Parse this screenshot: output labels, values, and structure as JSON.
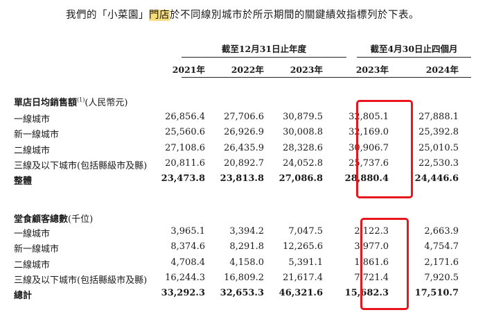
{
  "intro": {
    "before": "我們的「小菜園」",
    "highlight": "門店",
    "after": "於不同線別城市於所示期間的關鍵績效指標列於下表。"
  },
  "header": {
    "group1": "截至12月31日止年度",
    "group2": "截至4月30日止四個月",
    "years": [
      "2021年",
      "2022年",
      "2023年",
      "2023年",
      "2024年"
    ]
  },
  "section1": {
    "title": "單店日均銷售額",
    "note": "(1)",
    "unit": "(人民幣元)",
    "rows": [
      {
        "label": "一線城市",
        "values": [
          "26,856.4",
          "27,706.6",
          "30,879.5",
          "32,805.1",
          "27,888.1"
        ]
      },
      {
        "label": "新一線城市",
        "values": [
          "25,560.6",
          "26,926.9",
          "30,008.8",
          "32,169.0",
          "25,392.8"
        ]
      },
      {
        "label": "二線城市",
        "values": [
          "27,108.6",
          "26,435.9",
          "28,328.6",
          "30,906.7",
          "25,010.5"
        ]
      },
      {
        "label": "三線及以下城市(包括縣級市及縣)",
        "values": [
          "20,811.6",
          "20,892.7",
          "24,052.8",
          "25,737.6",
          "22,530.3"
        ]
      },
      {
        "label": "整體",
        "values": [
          "23,473.8",
          "23,813.8",
          "27,086.8",
          "28,880.4",
          "24,446.6"
        ],
        "total": true
      }
    ]
  },
  "section2": {
    "title": "堂食顧客總數",
    "unit": "(千位)",
    "rows": [
      {
        "label": "一線城市",
        "values": [
          "3,965.1",
          "3,394.2",
          "7,047.5",
          "2,122.3",
          "2,663.9"
        ]
      },
      {
        "label": "新一線城市",
        "values": [
          "8,374.6",
          "8,291.8",
          "12,265.6",
          "3,977.0",
          "4,754.7"
        ]
      },
      {
        "label": "二線城市",
        "values": [
          "4,708.4",
          "4,158.0",
          "5,391.1",
          "1,861.6",
          "2,171.6"
        ]
      },
      {
        "label": "三線及以下城市(包括縣級市及縣)",
        "values": [
          "16,244.3",
          "16,809.2",
          "21,617.4",
          "7,721.4",
          "7,920.5"
        ]
      },
      {
        "label": "總計",
        "values": [
          "33,292.3",
          "32,653.3",
          "46,321.6",
          "15,682.3",
          "17,510.7"
        ],
        "total": true
      }
    ]
  },
  "colors": {
    "highlight": "#f6dc7a",
    "red_box": "#e8161c"
  }
}
